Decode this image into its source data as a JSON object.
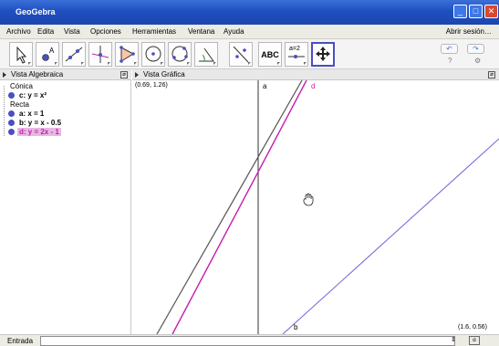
{
  "window": {
    "title": "GeoGebra",
    "minimize_label": "_",
    "maximize_label": "□",
    "close_label": "✕"
  },
  "menu": {
    "items": [
      "Archivo",
      "Edita",
      "Vista",
      "Opciones",
      "Herramientas",
      "Ventana",
      "Ayuda"
    ],
    "signin": "Abrir sesión…"
  },
  "toolbar": {
    "tools": [
      "move-tool",
      "point-tool",
      "line-tool",
      "perpendicular-tool",
      "polygon-tool",
      "circle-tool",
      "conic-tool",
      "angle-tool",
      "reflect-tool",
      "text-tool",
      "slider-tool",
      "move-graphics-tool"
    ],
    "text_tool_label": "ABC",
    "slider_tool_label": "a=2",
    "undo_label": "↶",
    "redo_label": "↷",
    "help_label": "?",
    "settings_label": "⚙"
  },
  "algebra": {
    "title": "Vista Algebraica",
    "categories": [
      {
        "name": "Cónica",
        "items": [
          {
            "label": "c: y = x²",
            "selected": false
          }
        ]
      },
      {
        "name": "Recta",
        "items": [
          {
            "label": "a: x = 1",
            "selected": false
          },
          {
            "label": "b: y = x - 0.5",
            "selected": false
          },
          {
            "label": "d: y = 2x - 1",
            "selected": true
          }
        ]
      }
    ]
  },
  "graphics": {
    "title": "Vista Gráfica",
    "top_left_coord": "(0.69, 1.26)",
    "bottom_right_coord": "(1.6, 0.56)",
    "line_labels": {
      "a": "a",
      "b": "b",
      "d": "d"
    },
    "colors": {
      "dark_line": "#555555",
      "b_line": "#7a5bd6",
      "d_line": "#c21fae",
      "axis_a": "#333333"
    }
  },
  "input": {
    "label": "Entrada",
    "arrows": "⇕",
    "keyboard_label": "α"
  },
  "colors": {
    "accent": "#4a4fbf",
    "selected_bg": "#e7b8e3",
    "selected_text": "#c61fb4"
  }
}
